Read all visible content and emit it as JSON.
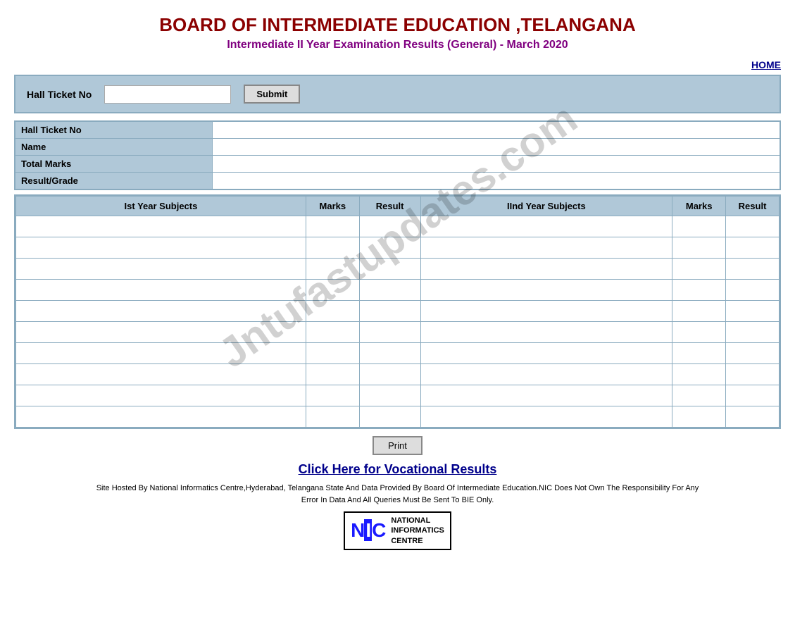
{
  "header": {
    "title": "BOARD OF INTERMEDIATE EDUCATION ,TELANGANA",
    "subtitle": "Intermediate II Year Examination Results  (General) -  March 2020"
  },
  "nav": {
    "home_label": "HOME"
  },
  "form": {
    "hall_ticket_label": "Hall Ticket No",
    "submit_label": "Submit",
    "input_placeholder": ""
  },
  "info_fields": [
    {
      "label": "Hall Ticket No",
      "value": ""
    },
    {
      "label": "Name",
      "value": ""
    },
    {
      "label": "Total Marks",
      "value": ""
    },
    {
      "label": "Result/Grade",
      "value": ""
    }
  ],
  "table": {
    "col1": "Ist Year Subjects",
    "col2": "Marks",
    "col3": "Result",
    "col4": "IInd Year Subjects",
    "col5": "Marks",
    "col6": "Result",
    "rows": [
      {
        "s1": "",
        "m1": "",
        "r1": "",
        "s2": "",
        "m2": "",
        "r2": ""
      },
      {
        "s1": "",
        "m1": "",
        "r1": "",
        "s2": "",
        "m2": "",
        "r2": ""
      },
      {
        "s1": "",
        "m1": "",
        "r1": "",
        "s2": "",
        "m2": "",
        "r2": ""
      },
      {
        "s1": "",
        "m1": "",
        "r1": "",
        "s2": "",
        "m2": "",
        "r2": ""
      },
      {
        "s1": "",
        "m1": "",
        "r1": "",
        "s2": "",
        "m2": "",
        "r2": ""
      },
      {
        "s1": "",
        "m1": "",
        "r1": "",
        "s2": "",
        "m2": "",
        "r2": ""
      },
      {
        "s1": "",
        "m1": "",
        "r1": "",
        "s2": "",
        "m2": "",
        "r2": ""
      },
      {
        "s1": "",
        "m1": "",
        "r1": "",
        "s2": "",
        "m2": "",
        "r2": ""
      },
      {
        "s1": "",
        "m1": "",
        "r1": "",
        "s2": "",
        "m2": "",
        "r2": ""
      },
      {
        "s1": "",
        "m1": "",
        "r1": "",
        "s2": "",
        "m2": "",
        "r2": ""
      }
    ]
  },
  "print": {
    "label": "Print"
  },
  "vocational": {
    "link_text": "Click Here for Vocational Results"
  },
  "footer": {
    "line1": "Site Hosted By National Informatics Centre,Hyderabad, Telangana  State And Data Provided By Board Of Intermediate Education.NIC Does Not Own The Responsibility For Any",
    "line2": "Error In Data And All Queries Must Be Sent To BIE Only."
  },
  "nic": {
    "letters": "NIC",
    "name": "NATIONAL\nINFORMATICS\nCENTRE"
  },
  "watermark": "Jntufastupdates.com"
}
